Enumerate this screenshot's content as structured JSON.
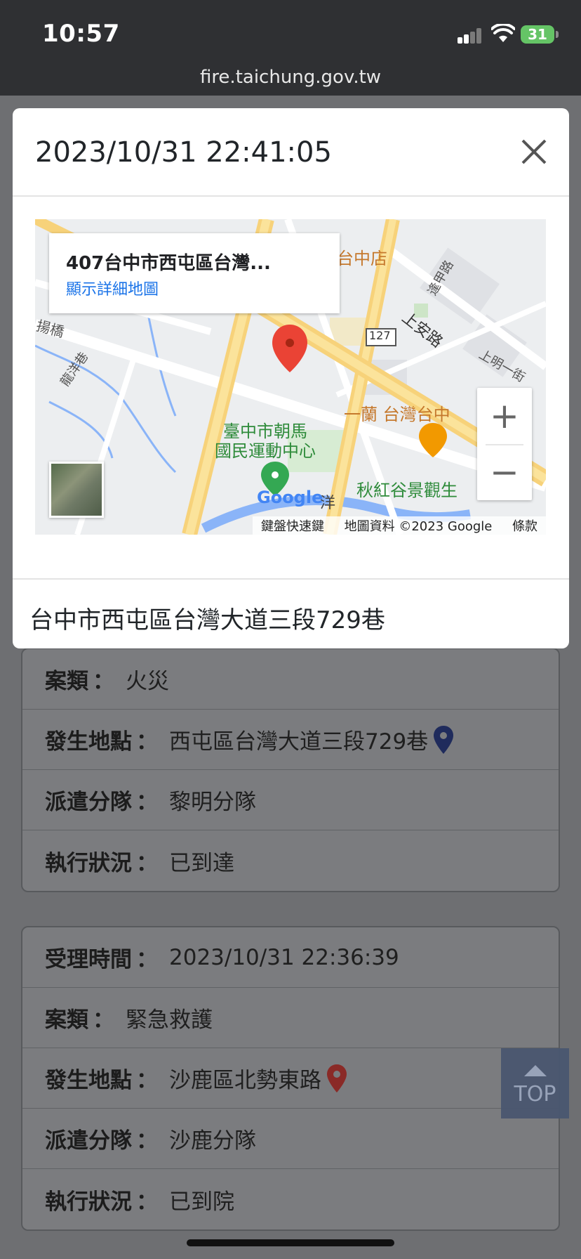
{
  "status_bar": {
    "time": "10:57",
    "battery": "31"
  },
  "browser": {
    "url": "fire.taichung.gov.tw"
  },
  "modal": {
    "title": "2023/10/31 22:41:05",
    "address": "台中市西屯區台灣大道三段729巷",
    "map": {
      "info_title": "407台中市西屯區台灣...",
      "info_link": "顯示詳細地圖",
      "footer": {
        "shortcuts": "鍵盤快速鍵",
        "data": "地圖資料 ©2023 Google",
        "terms": "條款"
      },
      "zoom_in": "+",
      "zoom_out": "−",
      "labels": {
        "store": "台中店",
        "road_shangan": "上安路",
        "road_fengjia": "逢甲路",
        "road_shangming": "上明一街",
        "route": "127",
        "restaurant": "一蘭 台灣台中",
        "sports_center_1": "臺中市朝馬",
        "sports_center_2": "國民運動中心",
        "restaurant2": "秋紅谷景觀生",
        "bridge": "揚橋",
        "longyang": "龍洋巷",
        "google": "Google",
        "yang": "洋"
      }
    }
  },
  "cards": [
    {
      "rows": [
        {
          "label": "案類",
          "value": "火災"
        },
        {
          "label": "發生地點",
          "value": "西屯區台灣大道三段729巷",
          "pin": "navy"
        },
        {
          "label": "派遣分隊",
          "value": "黎明分隊"
        },
        {
          "label": "執行狀況",
          "value": "已到達"
        }
      ]
    },
    {
      "rows": [
        {
          "label": "受理時間",
          "value": "2023/10/31 22:36:39"
        },
        {
          "label": "案類",
          "value": "緊急救護"
        },
        {
          "label": "發生地點",
          "value": "沙鹿區北勢東路",
          "pin": "red"
        },
        {
          "label": "派遣分隊",
          "value": "沙鹿分隊"
        },
        {
          "label": "執行狀況",
          "value": "已到院"
        }
      ]
    }
  ],
  "top_button": "TOP",
  "colors": {
    "pin_navy": "#1f2b5c",
    "pin_red": "#8a2a27",
    "map_pin": "#ea4335",
    "link": "#1a73e8"
  }
}
